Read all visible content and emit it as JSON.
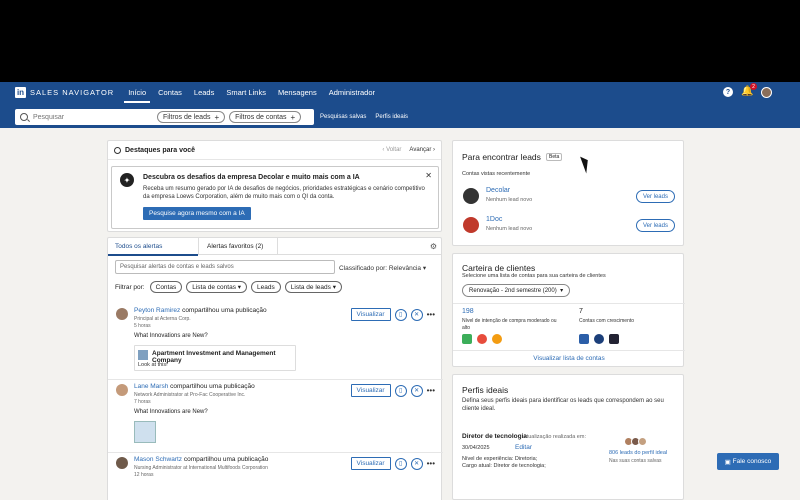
{
  "app": {
    "brand": "SALES NAVIGATOR",
    "logo_letter": "in"
  },
  "nav": {
    "items": [
      "Início",
      "Contas",
      "Leads",
      "Smart Links",
      "Mensagens",
      "Administrador"
    ],
    "active": "Início",
    "notif_count": "2"
  },
  "search": {
    "placeholder": "Pesquisar",
    "filters": [
      "Filtros de leads",
      "Filtros de contas"
    ],
    "links": [
      "Pesquisas salvas",
      "Perfis ideais"
    ]
  },
  "highlights": {
    "title": "Destaques para você",
    "prev": "Voltar",
    "next": "Avançar",
    "card_title": "Descubra os desafios da empresa Decolar e muito mais com a IA",
    "card_text": "Receba um resumo gerado por IA de desafios de negócios, prioridades estratégicas e cenário competitivo da empresa Loews Corporation, além de muito mais com o QI da conta.",
    "button": "Pesquise agora mesmo com a IA"
  },
  "alerts": {
    "tabs": [
      "Todos os alertas",
      "Alertas favoritos (2)"
    ],
    "search_placeholder": "Pesquisar alertas de contas e leads salvos",
    "sort_label": "Classificado por: Relevância",
    "filter_label": "Filtrar por:",
    "filters": [
      "Contas",
      "Lista de contas",
      "Leads",
      "Lista de leads"
    ],
    "view_label": "Visualizar",
    "items": [
      {
        "name": "Peyton Ramirez",
        "action": "compartilhou uma publicação",
        "sub": "Principal at Acterna Corp.",
        "time": "5 horas",
        "question": "What Innovations are New?",
        "company": "Apartment Investment and Management Company",
        "company_sub": "Look at this!"
      },
      {
        "name": "Lane Marsh",
        "action": "compartilhou uma publicação",
        "sub": "Network Administrator at Pro-Fac Cooperative Inc.",
        "time": "7 horas",
        "question": "What Innovations are New?"
      },
      {
        "name": "Mason Schwartz",
        "action": "compartilhou uma publicação",
        "sub": "Nursing Administrator at International Multifoods Corporation",
        "time": "12 horas"
      }
    ]
  },
  "find": {
    "title": "Para encontrar leads",
    "badge": "Beta",
    "subtitle": "Contas vistas recentemente",
    "button": "Ver leads",
    "accounts": [
      {
        "name": "Decolar",
        "sub": "Nenhum lead novo",
        "color": "#333333"
      },
      {
        "name": "1Doc",
        "sub": "Nenhum lead novo",
        "color": "#c0392b"
      }
    ]
  },
  "portfolio": {
    "title": "Carteira de clientes",
    "subtitle": "Selecione uma lista de contas para sua carteira de clientes",
    "dropdown": "Renovação - 2nd semestre (200)",
    "stat1_num": "198",
    "stat1_label": "Nível de intenção de compra moderado ou alto",
    "stat2_num": "7",
    "stat2_label": "Contas com crescimento",
    "link": "Visualizar lista de contas"
  },
  "ideal": {
    "title": "Perfis ideais",
    "text": "Defina seus perfis ideais para identificar os leads que correspondem ao seu cliente ideal.",
    "profile_title": "Diretor de tecnologia",
    "updated": "Atualização realizada em:",
    "date": "30/04/2025",
    "edit": "Editar",
    "exp": "Nível de experiência: Diretoria;",
    "role": "Cargo atual: Diretor de tecnologia;",
    "leads_link": "806 leads do perfil ideal",
    "leads_sub": "Nas suas contas salvas"
  },
  "contact_button": "Fale conosco"
}
